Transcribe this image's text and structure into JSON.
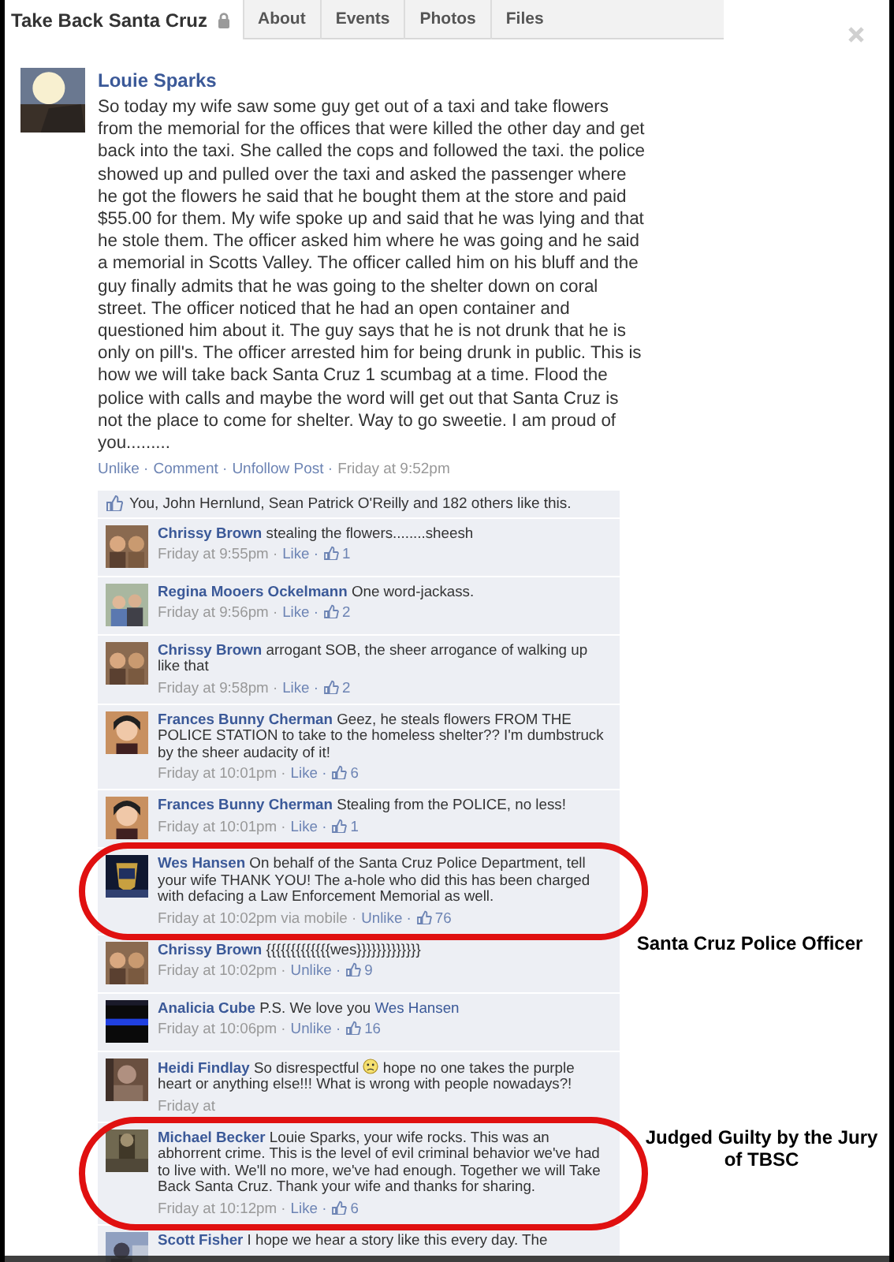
{
  "group": {
    "name": "Take Back Santa Cruz",
    "locked": true
  },
  "tabs": [
    {
      "label": "About",
      "selected": false
    },
    {
      "label": "Events",
      "selected": false
    },
    {
      "label": "Photos",
      "selected": false
    },
    {
      "label": "Files",
      "selected": false
    }
  ],
  "post": {
    "author": "Louie Sparks",
    "body": "So today my wife saw some guy get out of a taxi and take flowers from the memorial for the offices that were killed the other day and get back into the taxi. She called the cops and followed the taxi. the police showed up and pulled over the taxi and asked the passenger where he got the flowers he said that he bought them at the store and paid $55.00 for them. My wife spoke up and said that he was lying and that he stole them. The officer asked him where he was going and he said a memorial in Scotts Valley. The officer called him on his bluff and the guy finally admits that he was going to the shelter down on coral street. The officer noticed that he had an open container and questioned him about it. The guy says that he is not drunk that he is only on pill's. The officer arrested him for being drunk in public. This is how we will take back Santa Cruz 1 scumbag at a time. Flood the police with calls and maybe the word will get out that Santa Cruz is not the place to come for shelter. Way to go sweetie. I am proud of you.........",
    "actions": [
      "Unlike ·",
      "Comment ·",
      "Unfollow Post ·"
    ],
    "time": "Friday at 9:52pm"
  },
  "likes": {
    "text": "You, John Hernlund, Sean Patrick O'Reilly and 182 others like this."
  },
  "comments": [
    {
      "author": "Chrissy Brown",
      "text": "stealing the flowers........sheesh",
      "time": "Friday at 9:55pm ·",
      "action": "Like ·",
      "likes": "1"
    },
    {
      "author": "Regina Mooers Ockelmann",
      "text": "One word-jackass.",
      "time": "Friday at 9:56pm ·",
      "action": "Like ·",
      "likes": "2"
    },
    {
      "author": "Chrissy Brown",
      "text": "arrogant SOB, the sheer arrogance of walking up like that",
      "time": "Friday at 9:58pm ·",
      "action": "Like ·",
      "likes": "2"
    },
    {
      "author": "Frances Bunny Cherman",
      "text": "Geez, he steals flowers FROM THE POLICE STATION to take to the homeless shelter?? I'm dumbstruck by the sheer audacity of it!",
      "time": "Friday at 10:01pm ·",
      "action": "Like ·",
      "likes": "6"
    },
    {
      "author": "Frances Bunny Cherman",
      "text": "Stealing from the POLICE, no less!",
      "time": "Friday at 10:01pm ·",
      "action": "Like ·",
      "likes": "1"
    },
    {
      "author": "Wes Hansen",
      "text": "On behalf of the Santa Cruz Police Department, tell your wife THANK YOU! The a-hole who did this has been charged with defacing a Law Enforcement Memorial as well.",
      "time": "Friday at 10:02pm via mobile ·",
      "action": "Unlike ·",
      "likes": "76"
    },
    {
      "author": "Chrissy Brown",
      "text": "{{{{{{{{{{{{{wes}}}}}}}}}}}}}",
      "time": "Friday at 10:02pm ·",
      "action": "Unlike ·",
      "likes": "9"
    },
    {
      "author": "Analicia Cube",
      "text": "P.S. We love you",
      "mention": "Wes Hansen",
      "time": "Friday at 10:06pm ·",
      "action": "Unlike ·",
      "likes": "16"
    },
    {
      "author": "Heidi Findlay",
      "text": "So disrespectful",
      "emoticon": true,
      "text_after": "hope no one takes the purple heart or anything else!!! What is wrong with people nowadays?!",
      "time": "Friday at"
    },
    {
      "author": "Michael Becker",
      "text": "Louie Sparks, your wife rocks. This was an abhorrent crime. This is the level of evil criminal behavior we've had to live with. We'll no more, we've had enough. Together we will Take Back Santa Cruz. Thank your wife and thanks for sharing.",
      "time": "Friday at 10:12pm ·",
      "action": "Like ·",
      "likes": "6"
    },
    {
      "author": "Scott Fisher",
      "text": "I hope we hear a story like this every day. The"
    }
  ],
  "annotations": [
    {
      "text": "Santa Cruz Police Officer"
    },
    {
      "text": "Judged Guilty by the Jury of TBSC"
    }
  ]
}
